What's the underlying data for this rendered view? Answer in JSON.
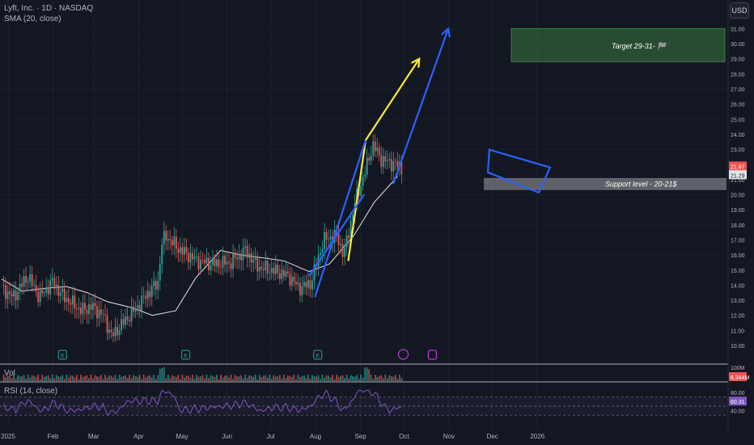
{
  "header": {
    "symbol_line": "Lyft, Inc. · 1D · NASDAQ",
    "sma_line": "SMA (20, close)",
    "currency": "USD"
  },
  "panes": {
    "volume_label": "Vol",
    "rsi_label": "RSI (14, close)"
  },
  "annotations": {
    "target_label": "Target 29-31- 🏁",
    "support_label": "Support level - 20-21$"
  },
  "colors": {
    "background": "#131722",
    "up": "#26a69a",
    "down": "#ef5350",
    "sma": "#e6e6e6",
    "rsi": "#7e57c2",
    "channel": "#2962ff",
    "arrow_yellow": "#ffeb3b",
    "target_zone": "#4caf50",
    "support_zone": "#9e9e9e"
  },
  "chart_data": {
    "type": "candlestick",
    "x_tick_labels": [
      "2025",
      "Feb",
      "Mar",
      "Apr",
      "May",
      "Jun",
      "Jul",
      "Aug",
      "Sep",
      "Oct",
      "Nov",
      "Dec",
      "2026"
    ],
    "price_axis": {
      "ticks": [
        "10.00",
        "11.00",
        "12.00",
        "13.00",
        "14.00",
        "15.00",
        "16.00",
        "17.00",
        "18.00",
        "19.00",
        "20.00",
        "21.00",
        "22.00",
        "23.00",
        "24.00",
        "25.00",
        "26.00",
        "27.00",
        "28.00",
        "29.00",
        "30.00",
        "31.00"
      ],
      "ylim": [
        9.8,
        32.3
      ],
      "last_price": "21.87",
      "sma_value": "21.29"
    },
    "volume_axis": {
      "ticks": [
        "100M"
      ],
      "last": "6.344M"
    },
    "rsi_axis": {
      "ticks": [
        "80.00",
        "40.00"
      ],
      "last": "60.31",
      "upper": 70,
      "lower": 30
    },
    "sma_20": [
      [
        "2025-01-01",
        14.4
      ],
      [
        "2025-01-15",
        13.6
      ],
      [
        "2025-02-01",
        13.8
      ],
      [
        "2025-02-15",
        13.9
      ],
      [
        "2025-03-01",
        13.5
      ],
      [
        "2025-03-15",
        12.9
      ],
      [
        "2025-04-01",
        12.5
      ],
      [
        "2025-04-15",
        12.0
      ],
      [
        "2025-05-01",
        12.3
      ],
      [
        "2025-05-15",
        14.5
      ],
      [
        "2025-06-01",
        16.3
      ],
      [
        "2025-06-15",
        16.0
      ],
      [
        "2025-07-01",
        15.8
      ],
      [
        "2025-07-15",
        15.6
      ],
      [
        "2025-08-01",
        14.9
      ],
      [
        "2025-08-15",
        15.4
      ],
      [
        "2025-09-01",
        17.3
      ],
      [
        "2025-09-15",
        19.5
      ],
      [
        "2025-10-01",
        21.2
      ]
    ],
    "earnings_markers": [
      "2025-02-12",
      "2025-05-08",
      "2025-08-07"
    ],
    "dividend_marker": "2025-10-05",
    "event_marker": "2025-10-25",
    "drawings": {
      "target_zone": [
        28.8,
        31.0
      ],
      "support_zone": [
        20.3,
        21.1
      ],
      "yellow_arrow": [
        [
          "2025-08-28",
          15.6
        ],
        [
          "2025-09-09",
          23.6
        ],
        [
          "2025-10-16",
          29.0
        ]
      ],
      "blue_channel_upper": [
        [
          "2025-08-05",
          13.2
        ],
        [
          "2025-09-09",
          23.6
        ]
      ],
      "blue_channel_lower": [
        [
          "2025-08-01",
          14.6
        ],
        [
          "2025-09-08",
          20.0
        ]
      ],
      "blue_arrow": [
        [
          "2025-09-28",
          20.7
        ],
        [
          "2025-11-05",
          31.0
        ]
      ]
    }
  }
}
